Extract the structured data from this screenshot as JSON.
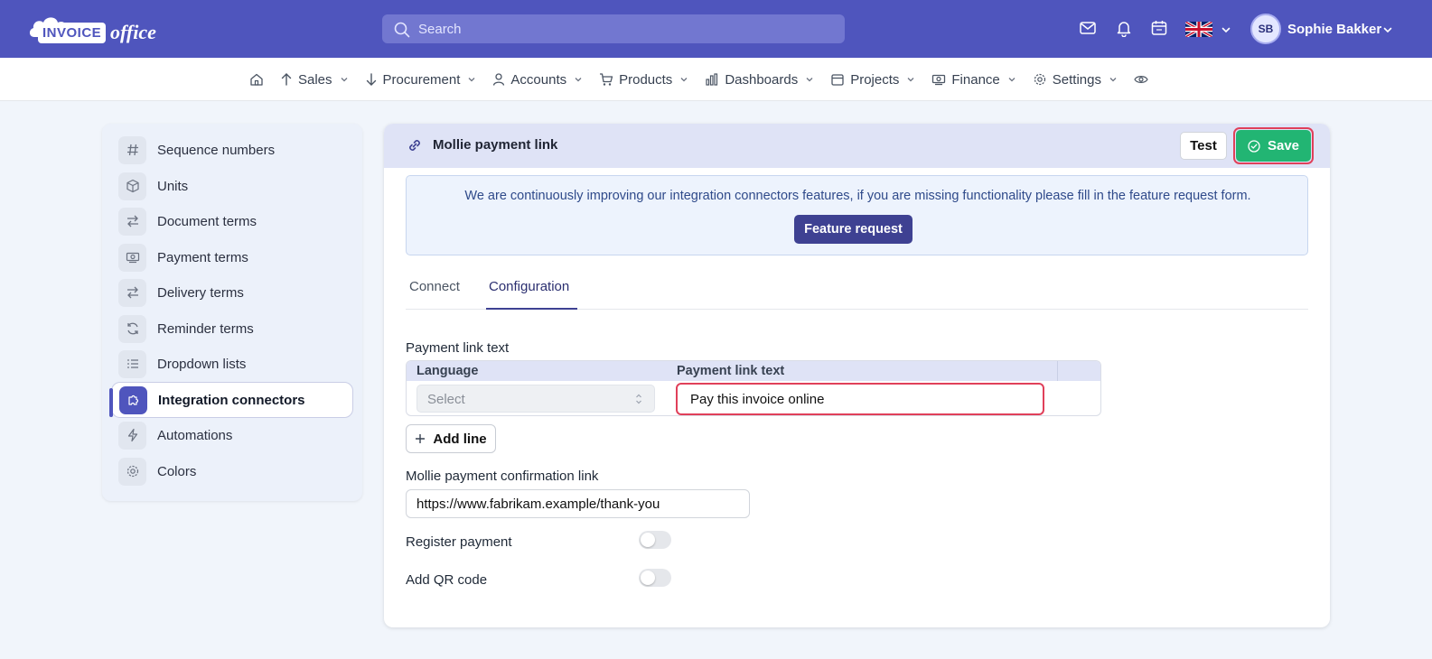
{
  "header": {
    "logo_text_1": "INVOICE",
    "logo_text_2": "office",
    "search_placeholder": "Search",
    "user_initials": "SB",
    "user_name": "Sophie Bakker",
    "icons": [
      "mail-icon",
      "bell-icon",
      "calendar-icon",
      "uk-flag-icon",
      "chevron-down-icon"
    ]
  },
  "nav": {
    "items": [
      {
        "label": "Sales",
        "icon": "arrow-up-icon"
      },
      {
        "label": "Procurement",
        "icon": "arrow-down-icon"
      },
      {
        "label": "Accounts",
        "icon": "user-icon"
      },
      {
        "label": "Products",
        "icon": "cart-icon"
      },
      {
        "label": "Dashboards",
        "icon": "bar-chart-icon"
      },
      {
        "label": "Projects",
        "icon": "calendar-icon"
      },
      {
        "label": "Finance",
        "icon": "money-icon"
      },
      {
        "label": "Settings",
        "icon": "gear-icon"
      }
    ]
  },
  "sidebar": {
    "items": [
      {
        "label": "Sequence numbers",
        "icon": "hash-icon"
      },
      {
        "label": "Units",
        "icon": "cube-icon"
      },
      {
        "label": "Document terms",
        "icon": "arrows-exchange-icon"
      },
      {
        "label": "Payment terms",
        "icon": "money-icon"
      },
      {
        "label": "Delivery terms",
        "icon": "arrows-exchange-icon"
      },
      {
        "label": "Reminder terms",
        "icon": "refresh-icon"
      },
      {
        "label": "Dropdown lists",
        "icon": "list-icon"
      },
      {
        "label": "Integration connectors",
        "icon": "puzzle-icon",
        "active": true
      },
      {
        "label": "Automations",
        "icon": "lightning-icon"
      },
      {
        "label": "Colors",
        "icon": "gear-icon"
      }
    ]
  },
  "card": {
    "title": "Mollie payment link",
    "test_label": "Test",
    "save_label": "Save",
    "notice_text": "We are continuously improving our integration connectors features, if you are missing functionality please fill in the feature request form.",
    "feature_request_label": "Feature request",
    "tabs": [
      {
        "label": "Connect",
        "active": false
      },
      {
        "label": "Configuration",
        "active": true
      }
    ],
    "payment_link_section_label": "Payment link text",
    "table": {
      "col_language": "Language",
      "col_payment_link_text": "Payment link text",
      "row": {
        "language_placeholder": "Select",
        "payment_link_text": "Pay this invoice online"
      }
    },
    "add_line_label": "Add line",
    "confirmation_label": "Mollie payment confirmation link",
    "confirmation_value": "https://www.fabrikam.example/thank-you",
    "register_payment_label": "Register payment",
    "register_payment_on": false,
    "add_qr_label": "Add QR code",
    "add_qr_on": false
  },
  "colors": {
    "brand": "#4f55bd",
    "save_green": "#22b573",
    "highlight_red": "#e0405a",
    "feature_button": "#3e4192"
  }
}
